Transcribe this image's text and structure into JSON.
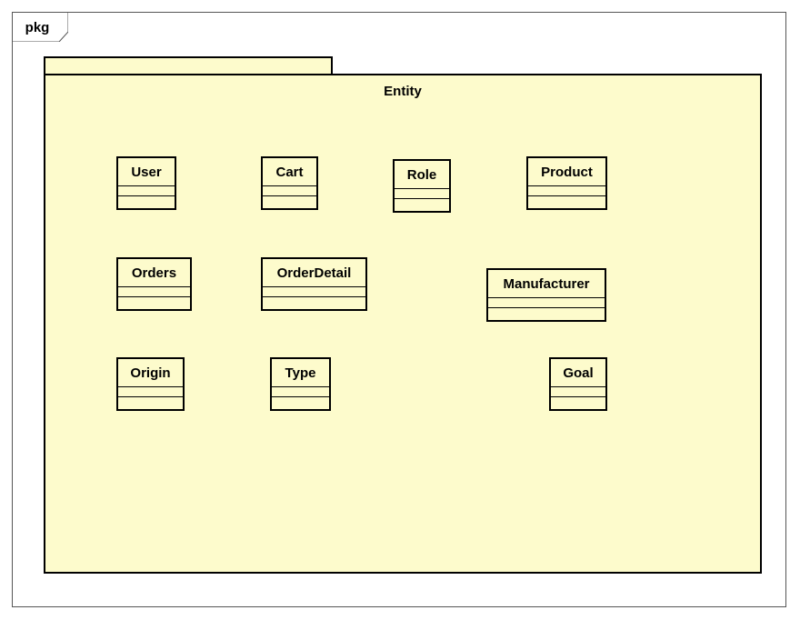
{
  "frame": {
    "label": "pkg"
  },
  "package": {
    "name": "Entity",
    "fill_color": "#fdfbcc"
  },
  "classes": [
    {
      "name": "User"
    },
    {
      "name": "Cart"
    },
    {
      "name": "Role"
    },
    {
      "name": "Product"
    },
    {
      "name": "Orders"
    },
    {
      "name": "OrderDetail"
    },
    {
      "name": "Manufacturer"
    },
    {
      "name": "Origin"
    },
    {
      "name": "Type"
    },
    {
      "name": "Goal"
    }
  ]
}
